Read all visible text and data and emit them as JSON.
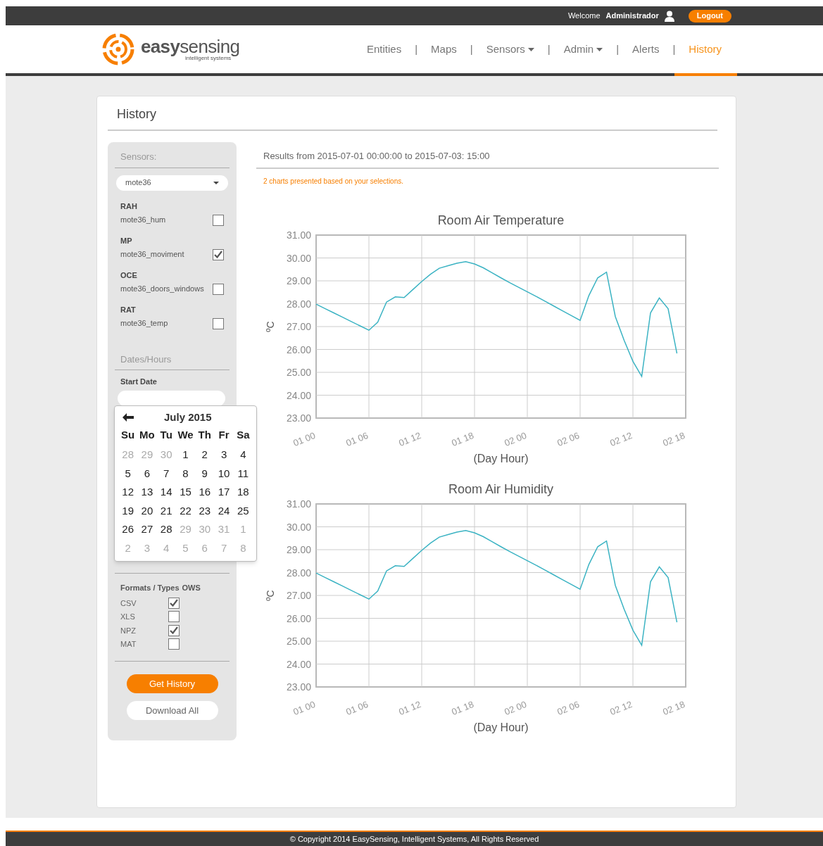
{
  "top_bar": {
    "welcome": "Welcome",
    "user": "Administrador",
    "logout": "Logout"
  },
  "brand": {
    "name_bold": "easy",
    "name_rest": "sensing",
    "tagline": "intelligent systems"
  },
  "nav": [
    {
      "label": "Entities",
      "dropdown": false,
      "selected": false
    },
    {
      "label": "Maps",
      "dropdown": false,
      "selected": false
    },
    {
      "label": "Sensors",
      "dropdown": true,
      "selected": false
    },
    {
      "label": "Admin",
      "dropdown": true,
      "selected": false
    },
    {
      "label": "Alerts",
      "dropdown": false,
      "selected": false
    },
    {
      "label": "History",
      "dropdown": false,
      "selected": true
    }
  ],
  "nav_separator": "|",
  "page_title": "History",
  "sidebar": {
    "sensors_heading": "Sensors:",
    "sensor_select": "mote36",
    "sensor_groups": [
      {
        "group": "RAH",
        "name": "mote36_hum",
        "checked": false
      },
      {
        "group": "MP",
        "name": "mote36_moviment",
        "checked": true
      },
      {
        "group": "OCE",
        "name": "mote36_doors_windows",
        "checked": false
      },
      {
        "group": "RAT",
        "name": "mote36_temp",
        "checked": false
      }
    ],
    "dates_heading": "Dates/Hours",
    "start_date_label": "Start Date",
    "calendar": {
      "month": "July 2015",
      "weekdays": [
        "Su",
        "Mo",
        "Tu",
        "We",
        "Th",
        "Fr",
        "Sa"
      ],
      "days": [
        {
          "d": "28",
          "outside": true
        },
        {
          "d": "29",
          "outside": true
        },
        {
          "d": "30",
          "outside": true
        },
        {
          "d": "1",
          "outside": false
        },
        {
          "d": "2",
          "outside": false
        },
        {
          "d": "3",
          "outside": false
        },
        {
          "d": "4",
          "outside": false
        },
        {
          "d": "5",
          "outside": false
        },
        {
          "d": "6",
          "outside": false
        },
        {
          "d": "7",
          "outside": false
        },
        {
          "d": "8",
          "outside": false
        },
        {
          "d": "9",
          "outside": false
        },
        {
          "d": "10",
          "outside": false
        },
        {
          "d": "11",
          "outside": false
        },
        {
          "d": "12",
          "outside": false
        },
        {
          "d": "13",
          "outside": false
        },
        {
          "d": "14",
          "outside": false
        },
        {
          "d": "15",
          "outside": false
        },
        {
          "d": "16",
          "outside": false
        },
        {
          "d": "17",
          "outside": false
        },
        {
          "d": "18",
          "outside": false
        },
        {
          "d": "19",
          "outside": false
        },
        {
          "d": "20",
          "outside": false
        },
        {
          "d": "21",
          "outside": false
        },
        {
          "d": "22",
          "outside": false
        },
        {
          "d": "23",
          "outside": false
        },
        {
          "d": "24",
          "outside": false
        },
        {
          "d": "25",
          "outside": false
        },
        {
          "d": "26",
          "outside": false
        },
        {
          "d": "27",
          "outside": false
        },
        {
          "d": "28",
          "outside": false
        },
        {
          "d": "29",
          "outside": true
        },
        {
          "d": "30",
          "outside": true
        },
        {
          "d": "31",
          "outside": true
        },
        {
          "d": "1",
          "outside": true
        },
        {
          "d": "2",
          "outside": true
        },
        {
          "d": "3",
          "outside": true
        },
        {
          "d": "4",
          "outside": true
        },
        {
          "d": "5",
          "outside": true
        },
        {
          "d": "6",
          "outside": true
        },
        {
          "d": "7",
          "outside": true
        },
        {
          "d": "8",
          "outside": true
        }
      ]
    },
    "formats_heading": "Formats / Types",
    "formats_extra": "OWS",
    "formats": [
      {
        "label": "CSV",
        "checked": true
      },
      {
        "label": "XLS",
        "checked": false
      },
      {
        "label": "NPZ",
        "checked": true
      },
      {
        "label": "MAT",
        "checked": false
      }
    ],
    "get_history": "Get History",
    "download_all": "Download All"
  },
  "results": {
    "heading": "Results from 2015-07-01 00:00:00 to 2015-07-03: 15:00",
    "note": "2 charts presented based on your selections."
  },
  "charts": [
    {
      "chart_data": {
        "type": "line",
        "title": "Room Air Temperature",
        "xlabel": "(Day Hour)",
        "ylabel": "ºC",
        "ylim": [
          23,
          31
        ],
        "grid": true,
        "categories": [
          "01 00",
          null,
          null,
          null,
          null,
          null,
          "01 06",
          null,
          null,
          null,
          null,
          null,
          "01 12",
          null,
          null,
          null,
          null,
          null,
          "01 18",
          null,
          null,
          null,
          null,
          null,
          "02 00",
          null,
          null,
          null,
          null,
          null,
          "02 06",
          null,
          null,
          null,
          null,
          null,
          "02 12",
          null,
          null,
          null,
          null,
          null,
          "02 18"
        ],
        "yticks": [
          {
            "value": 23,
            "label": "23.00"
          },
          {
            "value": 24,
            "label": "24.00"
          },
          {
            "value": 25,
            "label": "25.00"
          },
          {
            "value": 26,
            "label": "26.00"
          },
          {
            "value": 27,
            "label": "27.00"
          },
          {
            "value": 28,
            "label": "28.00"
          },
          {
            "value": 29,
            "label": "29.00"
          },
          {
            "value": 30,
            "label": "30.00"
          },
          {
            "value": 31,
            "label": "31.00"
          }
        ],
        "series": [
          {
            "color": "#3bb3c3",
            "values": [
              27.98,
              27.79,
              27.6,
              27.41,
              27.22,
              27.03,
              26.84,
              27.19,
              28.07,
              28.3,
              28.27,
              28.62,
              28.97,
              29.29,
              29.55,
              29.66,
              29.77,
              29.84,
              29.74,
              29.57,
              29.35,
              29.13,
              28.92,
              28.72,
              28.52,
              28.32,
              28.11,
              27.9,
              27.69,
              27.48,
              27.27,
              28.36,
              29.13,
              29.38,
              27.44,
              26.4,
              25.48,
              24.82,
              27.6,
              28.25,
              27.78,
              25.83,
              null
            ]
          }
        ]
      }
    },
    {
      "chart_data": {
        "type": "line",
        "title": "Room Air Humidity",
        "xlabel": "(Day Hour)",
        "ylabel": "ºC",
        "ylim": [
          23,
          31
        ],
        "grid": true,
        "categories": [
          "01 00",
          null,
          null,
          null,
          null,
          null,
          "01 06",
          null,
          null,
          null,
          null,
          null,
          "01 12",
          null,
          null,
          null,
          null,
          null,
          "01 18",
          null,
          null,
          null,
          null,
          null,
          "02 00",
          null,
          null,
          null,
          null,
          null,
          "02 06",
          null,
          null,
          null,
          null,
          null,
          "02 12",
          null,
          null,
          null,
          null,
          null,
          "02 18"
        ],
        "yticks": [
          {
            "value": 23,
            "label": "23.00"
          },
          {
            "value": 24,
            "label": "24.00"
          },
          {
            "value": 25,
            "label": "25.00"
          },
          {
            "value": 26,
            "label": "26.00"
          },
          {
            "value": 27,
            "label": "27.00"
          },
          {
            "value": 28,
            "label": "28.00"
          },
          {
            "value": 29,
            "label": "29.00"
          },
          {
            "value": 30,
            "label": "30.00"
          },
          {
            "value": 31,
            "label": "31.00"
          }
        ],
        "series": [
          {
            "color": "#3bb3c3",
            "values": [
              27.98,
              27.79,
              27.6,
              27.41,
              27.22,
              27.03,
              26.84,
              27.19,
              28.07,
              28.3,
              28.27,
              28.62,
              28.97,
              29.29,
              29.55,
              29.66,
              29.77,
              29.84,
              29.74,
              29.57,
              29.35,
              29.13,
              28.92,
              28.72,
              28.52,
              28.32,
              28.11,
              27.9,
              27.69,
              27.48,
              27.27,
              28.36,
              29.13,
              29.38,
              27.44,
              26.4,
              25.48,
              24.82,
              27.6,
              28.25,
              27.78,
              25.83,
              null
            ]
          }
        ]
      }
    }
  ],
  "footer": "© Copyright 2014 EasySensing, Intelligent Systems, All Rights Reserved"
}
